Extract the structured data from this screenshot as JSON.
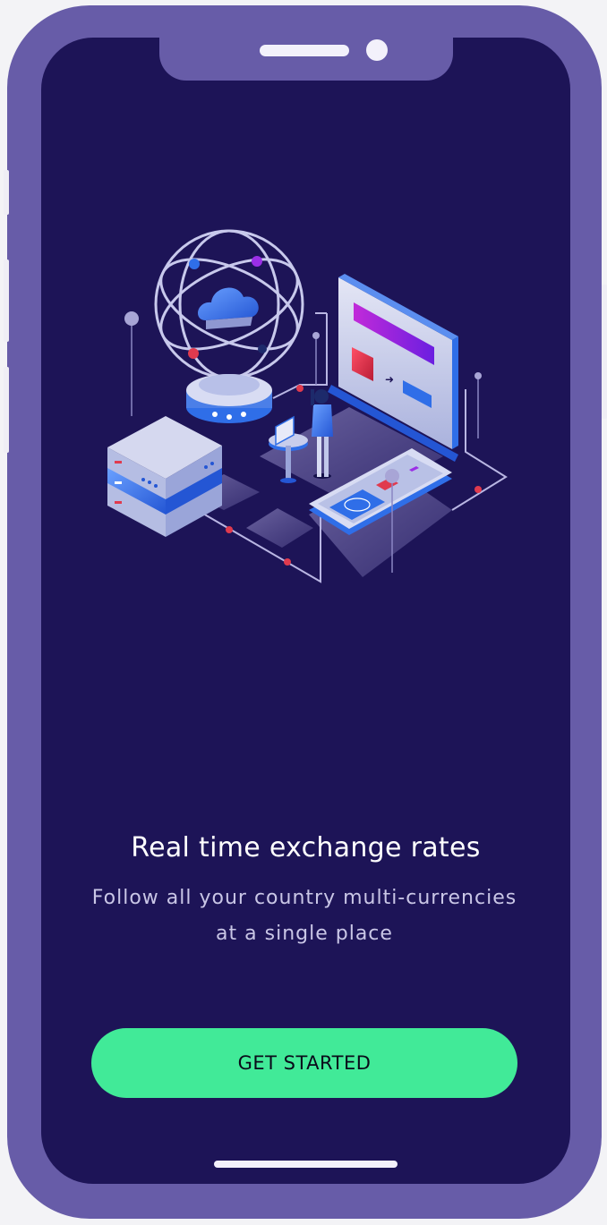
{
  "onboarding": {
    "title": "Real time exchange rates",
    "subtitle_line1": "Follow all your country multi-currencies",
    "subtitle_line2": "at a single place",
    "cta_label": "GET STARTED"
  },
  "colors": {
    "frame": "#675ca8",
    "screen_background": "#1d1457",
    "accent": "#41ea98",
    "illustration_blue": "#2f6ee8",
    "illustration_purple": "#9b2fe6",
    "illustration_red": "#e03a4e"
  },
  "illustration": {
    "icons": [
      "globe-icon",
      "cloud-icon",
      "server-rack-icon",
      "monitor-icon",
      "person-icon",
      "smartphone-icon",
      "laptop-icon"
    ]
  }
}
